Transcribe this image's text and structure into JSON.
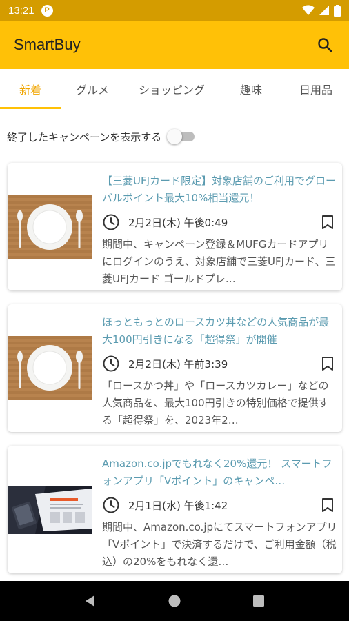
{
  "status_bar": {
    "time": "13:21",
    "notif_glyph": "P"
  },
  "app_bar": {
    "title": "SmartBuy"
  },
  "tabs": [
    {
      "label": "新着"
    },
    {
      "label": "グルメ"
    },
    {
      "label": "ショッピング"
    },
    {
      "label": "趣味"
    },
    {
      "label": "日用品"
    }
  ],
  "active_tab": "新着",
  "toggle": {
    "label": "終了したキャンペーンを表示する",
    "on": false
  },
  "items": [
    {
      "title": "【三菱UFJカード限定】対象店舗のご利用でグローバルポイント最大10%相当還元！",
      "date": "2月2日(木) 午後0:49",
      "description": "期間中、キャンペーン登録＆MUFGカードアプリにログインのうえ、対象店舗で三菱UFJカード、三菱UFJカード ゴールドプレ…",
      "thumbnail": "plate-photo"
    },
    {
      "title": "ほっともっとのロースカツ丼などの人気商品が最大100円引きになる「超得祭」が開催",
      "date": "2月2日(木) 午前3:39",
      "description": "「ロースかつ丼」や「ロースカツカレー」などの人気商品を、最大100円引きの特別価格で提供する「超得祭」を、2023年2…",
      "thumbnail": "plate-photo"
    },
    {
      "title": "Amazon.co.jpでもれなく20%還元！ スマートフォンアプリ「Vポイント」のキャンペ…",
      "date": "2月1日(水) 午後1:42",
      "description": "期間中、Amazon.co.jpにてスマートフォンアプリ「Vポイント」で決済するだけで、ご利用金額（税込）の20%をもれなく還…",
      "thumbnail": "app-screenshot-photo"
    }
  ],
  "colors": {
    "status_bar": "#d49c00",
    "app_bar": "#ffc107",
    "accent": "#f0a500",
    "title_text": "#5b9bb0"
  }
}
